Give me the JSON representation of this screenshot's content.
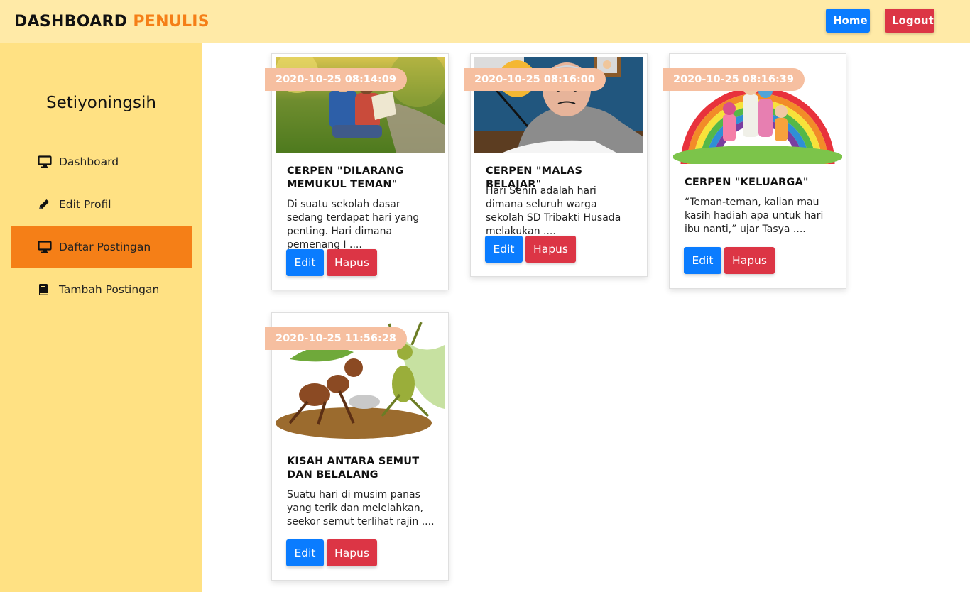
{
  "header": {
    "brand_part1": "DASHBOARD",
    "brand_part2": "PENULIS",
    "home_label": "Home",
    "logout_label": "Logout"
  },
  "sidebar": {
    "user_name": "Setiyoningsih",
    "items": [
      {
        "label": "Dashboard",
        "icon": "monitor-icon"
      },
      {
        "label": "Edit Profil",
        "icon": "pencil-icon"
      },
      {
        "label": "Daftar Postingan",
        "icon": "monitor-icon",
        "active": true
      },
      {
        "label": "Tambah Postingan",
        "icon": "book-icon"
      }
    ]
  },
  "posts": [
    {
      "date": "2020-10-25 08:14:09",
      "title": "CERPEN \"DILARANG MEMUKUL TEMAN\"",
      "excerpt": "Di suatu sekolah dasar sedang terdapat hari yang penting. Hari dimana pemenang I ....",
      "edit_label": "Edit",
      "delete_label": "Hapus"
    },
    {
      "date": "2020-10-25 08:16:00",
      "title": "CERPEN \"MALAS BELAJAR\"",
      "excerpt": "Hari Senin adalah hari dimana seluruh warga sekolah SD Tribakti Husada melakukan ....",
      "edit_label": "Edit",
      "delete_label": "Hapus"
    },
    {
      "date": "2020-10-25 08:16:39",
      "title": "CERPEN \"KELUARGA\"",
      "excerpt": "“Teman-teman, kalian mau kasih hadiah apa untuk hari ibu nanti,” ujar Tasya ....",
      "edit_label": "Edit",
      "delete_label": "Hapus"
    },
    {
      "date": "2020-10-25 11:56:28",
      "title": "KISAH ANTARA SEMUT DAN BELALANG",
      "excerpt": "Suatu hari di musim panas yang terik dan melelahkan, seekor semut terlihat rajin ....",
      "edit_label": "Edit",
      "delete_label": "Hapus"
    }
  ],
  "colors": {
    "topbar_bg": "#ffeaa7",
    "sidebar_bg": "#ffe183",
    "accent_orange": "#f57f17",
    "primary_blue": "#0a7cff",
    "danger_red": "#dc3545",
    "date_badge": "#f6bfa0"
  }
}
